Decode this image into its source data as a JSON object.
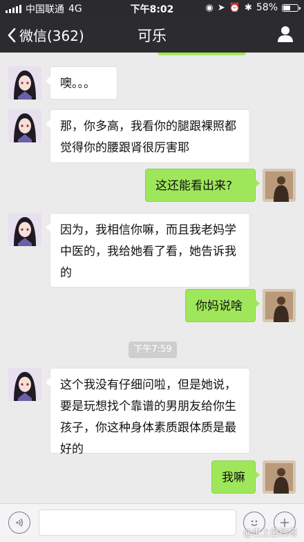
{
  "status_bar": {
    "carrier": "中国联通",
    "network": "4G",
    "time": "下午8:02",
    "battery": "58%",
    "battery_level": 0.58
  },
  "nav": {
    "back_label": "微信(362)",
    "title": "可乐",
    "profile_icon": "person-icon"
  },
  "messages": [
    {
      "direction": "in",
      "text": "噢。。。"
    },
    {
      "direction": "in",
      "text": "那，你多高，我看你的腿跟裸照都觉得你的腰跟肾很厉害耶"
    },
    {
      "direction": "out",
      "text": "这还能看出来?"
    },
    {
      "direction": "in",
      "text": "因为，我相信你嘛，而且我老妈学中医的，我给她看了看，她告诉我的"
    },
    {
      "direction": "out",
      "text": "你妈说啥"
    },
    {
      "direction": "timestamp",
      "text": "下午7:59"
    },
    {
      "direction": "in",
      "text": "这个我没有仔细问啦，但是她说，要是玩想找个靠谱的男朋友给你生孩子，你这种身体素质跟体质是最好的"
    },
    {
      "direction": "out",
      "text": "我嘛"
    }
  ],
  "input_bar": {
    "voice_icon": "voice-icon",
    "emoji_icon": "emoji-icon",
    "plus_icon": "plus-icon",
    "watermark": "@史上最贱嗯"
  },
  "colors": {
    "nav_bg": "#2c2c30",
    "chat_bg": "#ebebeb",
    "outgoing_bubble": "#9fe75a",
    "incoming_bubble": "#ffffff"
  }
}
